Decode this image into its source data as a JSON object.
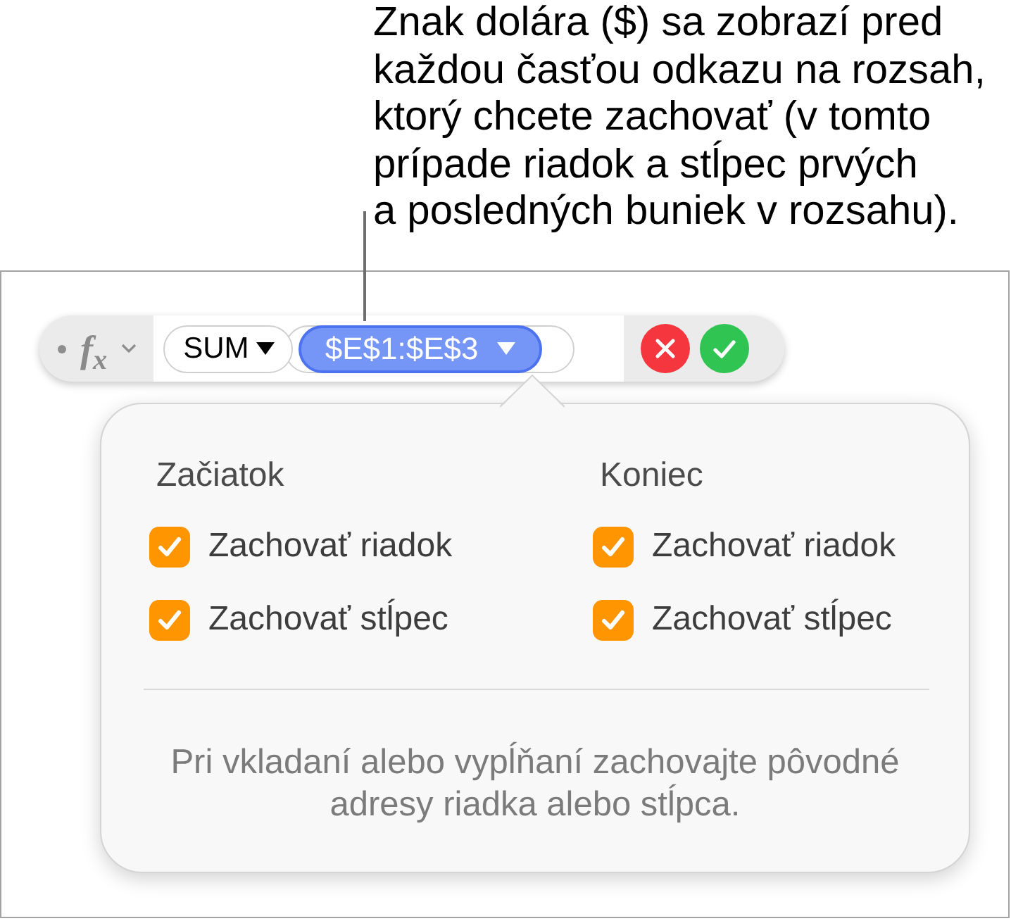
{
  "callout": {
    "text": "Znak dolára ($) sa zobrazí pred\nkaždou časťou odkazu na rozsah,\nktorý chcete zachovať (v tomto\nprípade riadok a stĺpec prvých\na posledných buniek v rozsahu)."
  },
  "formula_bar": {
    "function_button": "f$_{x}$",
    "function_token": {
      "text": "SUM"
    },
    "range_token": {
      "text": "$E$1:$E$3",
      "selected": true
    }
  },
  "popover": {
    "columns": [
      {
        "heading": "Začiatok",
        "options": [
          {
            "label": "Zachovať riadok",
            "checked": true
          },
          {
            "label": "Zachovať stĺpec",
            "checked": true
          }
        ]
      },
      {
        "heading": "Koniec",
        "options": [
          {
            "label": "Zachovať riadok",
            "checked": true
          },
          {
            "label": "Zachovať stĺpec",
            "checked": true
          }
        ]
      }
    ],
    "note": "Pri vkladaní alebo vypĺňaní zachovajte pôvodné\nadresy riadka alebo stĺpca."
  }
}
